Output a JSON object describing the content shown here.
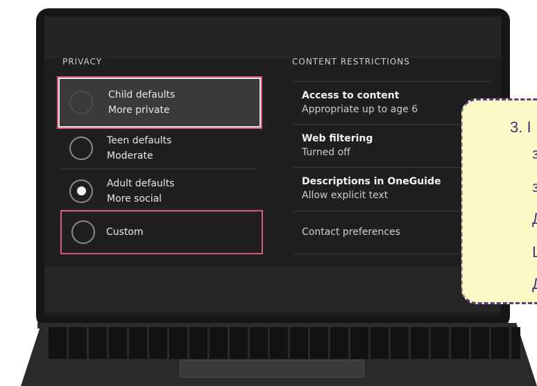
{
  "privacy": {
    "title": "PRIVACY",
    "options": [
      {
        "line1": "Child defaults",
        "line2": "More private",
        "selected": false
      },
      {
        "line1": "Teen defaults",
        "line2": "Moderate",
        "selected": false
      },
      {
        "line1": "Adult defaults",
        "line2": "More social",
        "selected": true
      },
      {
        "line1": "Custom",
        "line2": "",
        "selected": false
      }
    ]
  },
  "content": {
    "title": "CONTENT RESTRICTIONS",
    "rows": [
      {
        "title": "Access to content",
        "sub": "Appropriate up to age 6"
      },
      {
        "title": "Web filtering",
        "sub": "Turned off"
      },
      {
        "title": "Descriptions in OneGuide",
        "sub": "Allow explicit text"
      },
      {
        "title": "",
        "sub": "Contact preferences"
      }
    ]
  },
  "callout": {
    "number": "3. I",
    "fragments": [
      "з",
      "з",
      "Д",
      "Ц",
      "Д"
    ]
  }
}
